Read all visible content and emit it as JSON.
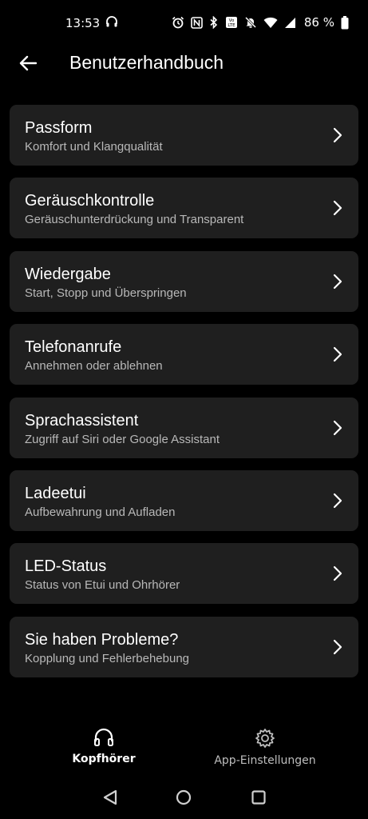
{
  "status": {
    "time": "13:53",
    "battery_text": "86 %",
    "icons": [
      "headphones-icon",
      "alarm-icon",
      "nfc-icon",
      "bluetooth-icon",
      "volte-icon",
      "mute-icon",
      "wifi-icon",
      "signal-icon",
      "battery-icon"
    ]
  },
  "header": {
    "title": "Benutzerhandbuch",
    "back_icon": "back-arrow-icon"
  },
  "items": [
    {
      "title": "Passform",
      "subtitle": "Komfort und Klangqualität"
    },
    {
      "title": "Geräuschkontrolle",
      "subtitle": "Geräuschunterdrückung und Transparent"
    },
    {
      "title": "Wiedergabe",
      "subtitle": "Start, Stopp und Überspringen"
    },
    {
      "title": "Telefonanrufe",
      "subtitle": "Annehmen oder ablehnen"
    },
    {
      "title": "Sprachassistent",
      "subtitle": "Zugriff auf Siri oder Google Assistant"
    },
    {
      "title": "Ladeetui",
      "subtitle": "Aufbewahrung und Aufladen"
    },
    {
      "title": "LED-Status",
      "subtitle": "Status von Etui und Ohrhörer"
    },
    {
      "title": "Sie haben Probleme?",
      "subtitle": "Kopplung und Fehlerbehebung"
    }
  ],
  "bottom_nav": {
    "tab1_label": "Kopfhörer",
    "tab2_label": "App-Einstellungen"
  },
  "colors": {
    "background": "#000000",
    "card": "#1f1f1f",
    "subtitle": "#b8b8b8"
  }
}
